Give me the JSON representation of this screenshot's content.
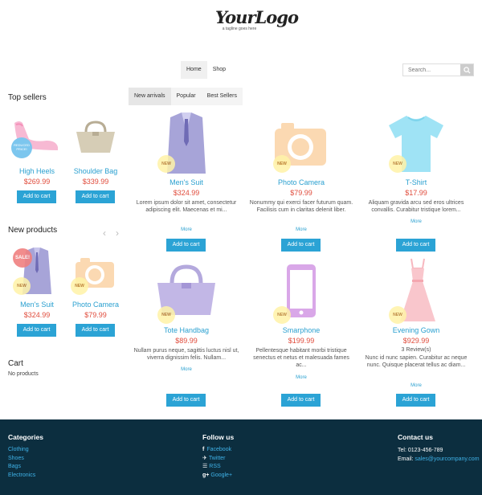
{
  "logo": {
    "main": "YourLogo",
    "sub": "a tagline goes here"
  },
  "nav": {
    "home": "Home",
    "shop": "Shop"
  },
  "search": {
    "placeholder": "Search..."
  },
  "tabs": {
    "new_arrivals": "New arrivals",
    "popular": "Popular",
    "best_sellers": "Best Sellers"
  },
  "top_sellers": {
    "title": "Top sellers",
    "items": [
      {
        "name": "High Heels",
        "price": "$269.99",
        "badge": "REDUCED PRICE!",
        "button": "Add to cart"
      },
      {
        "name": "Shoulder Bag",
        "price": "$339.99",
        "button": "Add to cart"
      }
    ]
  },
  "new_products": {
    "title": "New products",
    "items": [
      {
        "name": "Men's Suit",
        "price": "$324.99",
        "badge": "NEW",
        "sale": "SALE!",
        "button": "Add to cart"
      },
      {
        "name": "Photo Camera",
        "price": "$79.99",
        "badge": "NEW",
        "button": "Add to cart"
      }
    ]
  },
  "cart": {
    "title": "Cart",
    "empty": "No products"
  },
  "products": [
    {
      "name": "Men's Suit",
      "price": "$324.99",
      "badge": "NEW",
      "desc": "Lorem ipsum dolor sit amet, consectetur adipiscing elit. Maecenas et mi...",
      "more": "More",
      "button": "Add to cart"
    },
    {
      "name": "Photo Camera",
      "price": "$79.99",
      "badge": "NEW",
      "desc": "Nonummy qui exerci facer futurum quam. Facilisis cum in claritas delenit liber.",
      "more": "More",
      "button": "Add to cart"
    },
    {
      "name": "T-Shirt",
      "price": "$17.99",
      "badge": "NEW",
      "desc": "Aliquam gravida arcu sed eros ultrices convallis. Curabitur tristique lorem...",
      "more": "More",
      "button": "Add to cart"
    },
    {
      "name": "Tote Handbag",
      "price": "$89.99",
      "badge": "NEW",
      "desc": "Nullam purus neque, sagittis luctus nisl ut, viverra dignissim felis. Nullam...",
      "more": "More",
      "button": "Add to cart"
    },
    {
      "name": "Smarphone",
      "price": "$199.99",
      "badge": "NEW",
      "desc": "Pellentesque habitant morbi tristique senectus et netus et malesuada fames ac...",
      "more": "More",
      "button": "Add to cart"
    },
    {
      "name": "Evening Gown",
      "price": "$929.99",
      "badge": "NEW",
      "reviews": "3 Review(s)",
      "desc": "Nunc id nunc sapien. Curabitur ac neque nunc. Quisque placerat tellus ac diam...",
      "more": "More",
      "button": "Add to cart"
    }
  ],
  "footer": {
    "categories": {
      "title": "Categories",
      "links": [
        "Clothing",
        "Shoes",
        "Bags",
        "Electronics"
      ]
    },
    "follow": {
      "title": "Follow us",
      "links": [
        "Facebook",
        "Twitter",
        "RSS",
        "Google+"
      ]
    },
    "contact": {
      "title": "Contact us",
      "tel": "Tel: 0123-456-789",
      "email_label": "Email:",
      "email": "sales@yourcompany.com"
    }
  },
  "colors": {
    "accent": "#2ba3d5",
    "price": "#e04c3c",
    "link": "#2aa0d0",
    "footer_bg": "#0c2e3f"
  }
}
